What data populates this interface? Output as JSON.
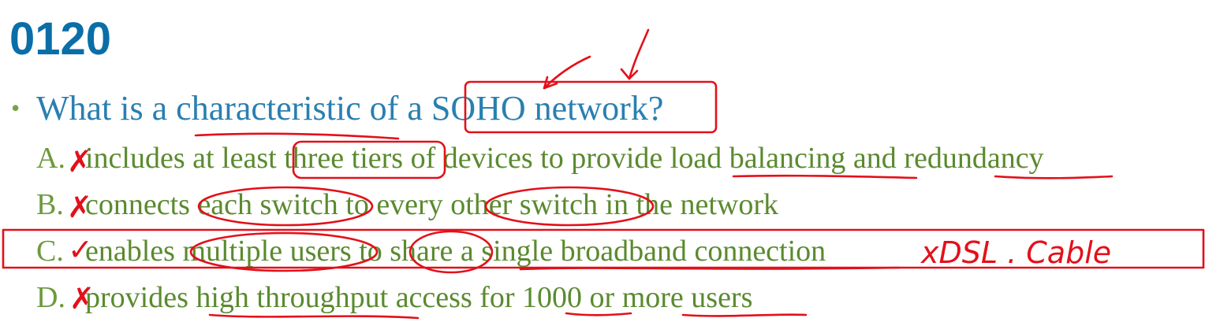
{
  "slide": {
    "title": "0120"
  },
  "question": {
    "bullet": "•",
    "text": "What is a characteristic of a SOHO network?"
  },
  "options": [
    {
      "letter": "A.",
      "text": "includes at least three tiers of devices to provide load balancing and redundancy",
      "mark": "✗"
    },
    {
      "letter": "B.",
      "text": "connects each switch to every other switch in the network",
      "mark": "✗"
    },
    {
      "letter": "C.",
      "text": "enables multiple users to share a single broadband connection",
      "mark": "✓"
    },
    {
      "letter": "D.",
      "text": "provides high throughput access for 1000 or more users",
      "mark": "✗"
    }
  ],
  "handwriting": {
    "note": "xDSL . Cable",
    "ink_color": "#e3101a"
  },
  "colors": {
    "title": "#0a6ea8",
    "question": "#2a7fb0",
    "options": "#5a8a2e"
  }
}
